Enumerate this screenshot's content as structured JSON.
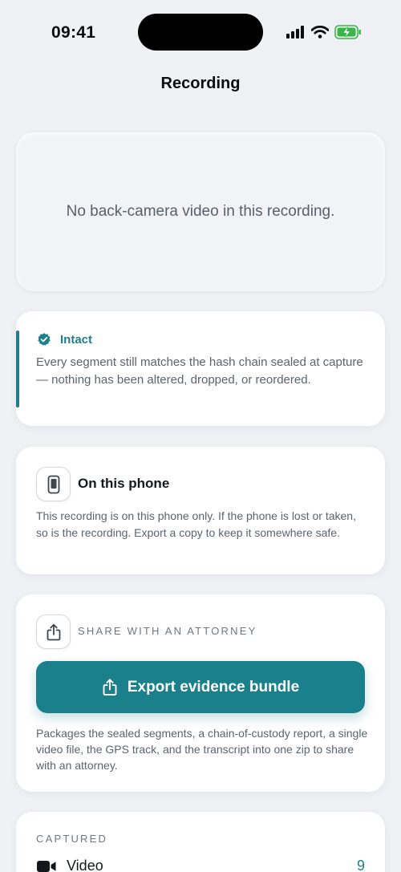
{
  "status_bar": {
    "time": "09:41",
    "icons": [
      "signal-icon",
      "wifi-icon",
      "battery-charging-icon"
    ]
  },
  "nav": {
    "title": "Recording"
  },
  "video": {
    "message": "No back-camera video in this recording."
  },
  "integrity": {
    "icon": "verified-check-icon",
    "title": "Intact",
    "body": "Every segment still matches the hash chain sealed at capture — nothing has been altered, dropped, or reordered."
  },
  "storage": {
    "icon": "phone-icon",
    "title": "On this phone",
    "body": "This recording is on this phone only. If the phone is lost or taken, so is the recording. Export a copy to keep it somewhere safe."
  },
  "share": {
    "icon": "share-icon",
    "heading": "SHARE WITH AN ATTORNEY",
    "button_label": "Export evidence bundle",
    "body": "Packages the sealed segments, a chain-of-custody report, a single video file, the GPS track, and the transcript into one zip to share with an attorney."
  },
  "captured": {
    "heading": "CAPTURED",
    "rows": [
      {
        "icon": "video-camera-icon",
        "label": "Video",
        "count": "9"
      }
    ]
  },
  "colors": {
    "accent": "#19808c",
    "background": "#eff1f5",
    "card": "#ffffff"
  }
}
